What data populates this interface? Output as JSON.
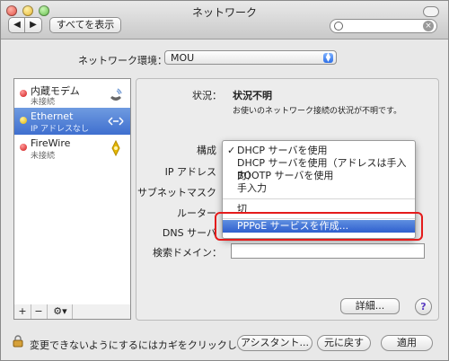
{
  "window": {
    "title": "ネットワーク"
  },
  "toolbar": {
    "back": "◀",
    "forward": "▶",
    "show_all": "すべてを表示"
  },
  "env": {
    "label": "ネットワーク環境：",
    "value": "MOU"
  },
  "services": [
    {
      "name": "内蔵モデム",
      "status": "未接続",
      "dot": "red",
      "icon": "phone-icon"
    },
    {
      "name": "Ethernet",
      "status": "IP アドレスなし",
      "dot": "yellow",
      "icon": "ethernet-icon"
    },
    {
      "name": "FireWire",
      "status": "未接続",
      "dot": "red",
      "icon": "firewire-icon"
    }
  ],
  "list_tools": {
    "add": "+",
    "remove": "−",
    "gear": "⚙▾"
  },
  "detail": {
    "status_label": "状況：",
    "status_value": "状況不明",
    "status_desc": "お使いのネットワーク接続の状況が不明です。",
    "config_label": "構成",
    "ip_label": "IP アドレス",
    "subnet_label": "サブネットマスク",
    "router_label": "ルーター",
    "dns_label": "DNS サーバ",
    "search_domain_label": "検索ドメイン：",
    "advanced_button": "詳細...",
    "help": "?"
  },
  "menu": {
    "items": [
      {
        "label": "DHCP サーバを使用",
        "checked": true
      },
      {
        "label": "DHCP サーバを使用（アドレスは手入力）",
        "checked": false
      },
      {
        "label": "BOOTP サーバを使用",
        "checked": false
      },
      {
        "label": "手入力",
        "checked": false
      },
      {
        "label": "切",
        "checked": false
      },
      {
        "label": "PPPoE サービスを作成...",
        "checked": false,
        "highlighted": true
      }
    ],
    "check_mark": "✓"
  },
  "bottom": {
    "lock_text": "変更できないようにするにはカギをクリックします。",
    "assistant": "アシスタント...",
    "revert": "元に戻す",
    "apply": "適用"
  },
  "colors": {
    "accent": "#3f6fcf",
    "highlight_box": "#e41b1b"
  }
}
